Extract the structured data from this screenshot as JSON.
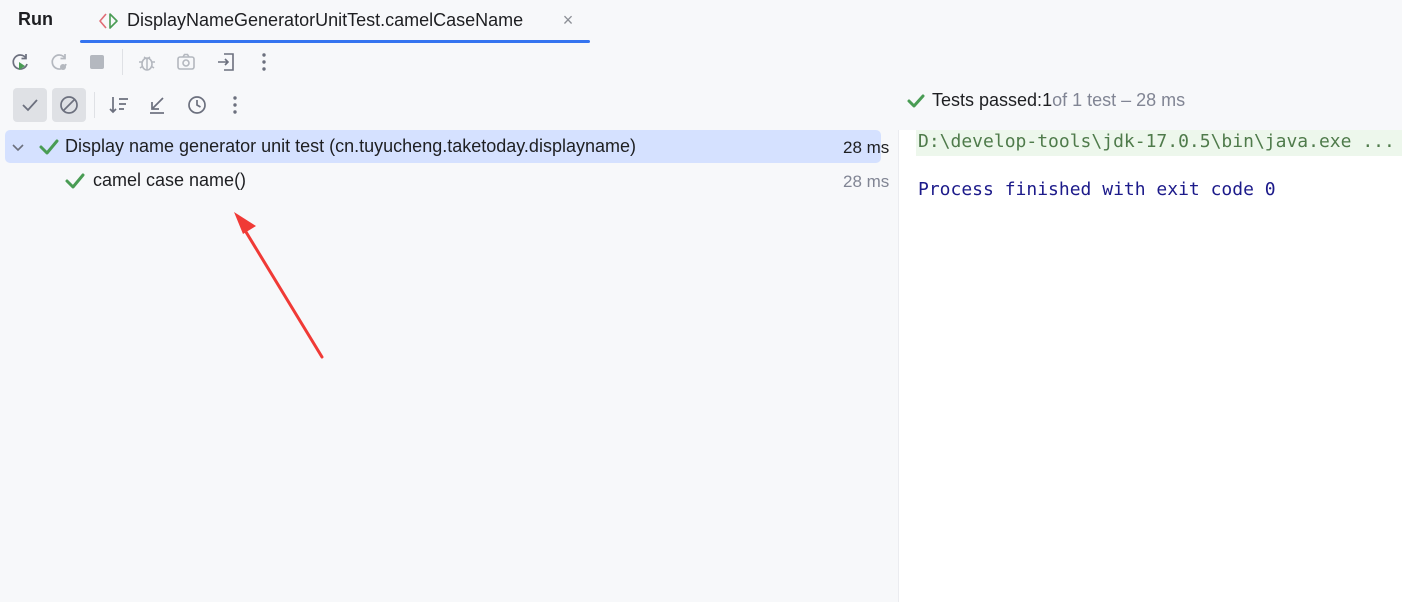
{
  "header": {
    "title": "Run",
    "tab_label": "DisplayNameGeneratorUnitTest.camelCaseName",
    "tab_close": "×"
  },
  "toolbar_top": {
    "items": [
      "rerun-icon",
      "rerun-failed-icon",
      "stop-icon",
      "debug-icon",
      "screenshot-icon",
      "export-icon",
      "more-icon"
    ]
  },
  "toolbar_tests": {
    "items": [
      "show-passed-icon",
      "show-ignored-icon",
      "sort-icon",
      "collapse-icon",
      "history-icon",
      "more-icon"
    ]
  },
  "status": {
    "prefix": "Tests passed: ",
    "passed": "1",
    "suffix": " of 1 test – 28 ms"
  },
  "tree": {
    "suite": {
      "label": "Display name generator unit test (cn.tuyucheng.taketoday.displayname)",
      "time": "28 ms"
    },
    "test": {
      "label": "camel case name()",
      "time": "28 ms"
    }
  },
  "console": {
    "command": "D:\\develop-tools\\jdk-17.0.5\\bin\\java.exe ...",
    "finished": "Process finished with exit code 0"
  },
  "colors": {
    "accent": "#3574f0",
    "success": "#499c54",
    "selection": "#d5e1ff",
    "annotation_arrow": "#f03a36"
  }
}
